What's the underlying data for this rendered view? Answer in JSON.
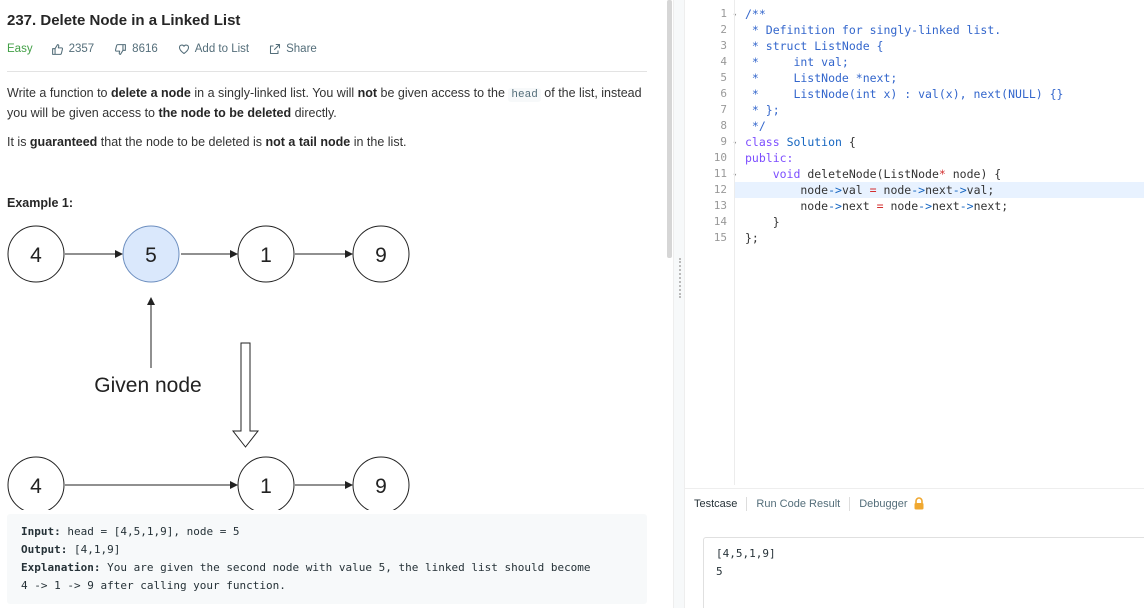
{
  "problem": {
    "title": "237. Delete Node in a Linked List",
    "difficulty": "Easy",
    "likes": "2357",
    "dislikes": "8616",
    "add_to_list": "Add to List",
    "share": "Share"
  },
  "description": {
    "p1_a": "Write a function to ",
    "p1_b": "delete a node",
    "p1_c": " in a singly-linked list. You will ",
    "p1_d": "not",
    "p1_e": " be given access to the ",
    "p1_code": "head",
    "p1_f": " of the list, instead you will be given access to ",
    "p1_g": "the node to be deleted",
    "p1_h": " directly.",
    "p2_a": "It is ",
    "p2_b": "guaranteed",
    "p2_c": " that the node to be deleted is ",
    "p2_d": "not a tail node",
    "p2_e": " in the list."
  },
  "example": {
    "title": "Example 1:",
    "diagram": {
      "top_nodes": [
        "4",
        "5",
        "1",
        "9"
      ],
      "bottom_nodes": [
        "4",
        "1",
        "9"
      ],
      "label": "Given node"
    },
    "input_label": "Input:",
    "input_value": " head = [4,5,1,9], node = 5",
    "output_label": "Output:",
    "output_value": " [4,1,9]",
    "explanation_label": "Explanation:",
    "explanation_value": " You are given the second node with value 5, the linked list should become\n4 -> 1 -> 9 after calling your function."
  },
  "editor": {
    "line_numbers": [
      "1",
      "2",
      "3",
      "4",
      "5",
      "6",
      "7",
      "8",
      "9",
      "10",
      "11",
      "12",
      "13",
      "14",
      "15"
    ],
    "fold_lines": [
      "1",
      "9",
      "11"
    ],
    "lines": [
      "/**",
      " * Definition for singly-linked list.",
      " * struct ListNode {",
      " *     int val;",
      " *     ListNode *next;",
      " *     ListNode(int x) : val(x), next(NULL) {}",
      " * };",
      " */",
      "class Solution {",
      "public:",
      "    void deleteNode(ListNode* node) {",
      "        node->val = node->next->val;",
      "        node->next = node->next->next;",
      "    }",
      "};"
    ]
  },
  "console": {
    "tabs": [
      "Testcase",
      "Run Code Result",
      "Debugger"
    ],
    "testcase": "[4,5,1,9]\n5"
  },
  "colors": {
    "easy": "#43a047",
    "node_highlight_fill": "#dae8fc",
    "node_highlight_stroke": "#6c8ebf",
    "lock": "#f0a830"
  }
}
